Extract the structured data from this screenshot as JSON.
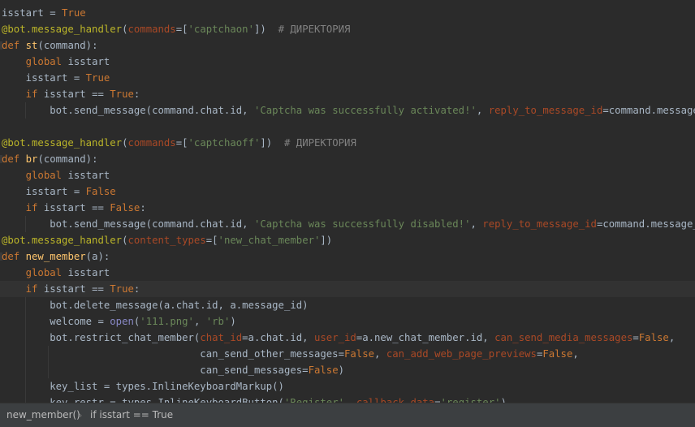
{
  "editor": {
    "lines": [
      "isstart = True",
      "@bot.message_handler(commands=['captchaon'])  # ДИРЕКТОРИЯ",
      "def st(command):",
      "    global isstart",
      "    isstart = True",
      "    if isstart == True:",
      "        bot.send_message(command.chat.id, 'Captcha was successfully activated!', reply_to_message_id=command.message_id)",
      "",
      "@bot.message_handler(commands=['captchaoff'])  # ДИРЕКТОРИЯ",
      "def br(command):",
      "    global isstart",
      "    isstart = False",
      "    if isstart == False:",
      "        bot.send_message(command.chat.id, 'Captcha was successfully disabled!', reply_to_message_id=command.message_id)",
      "@bot.message_handler(content_types=['new_chat_member'])",
      "def new_member(a):",
      "    global isstart",
      "    if isstart == True:",
      "        bot.delete_message(a.chat.id, a.message_id)",
      "        welcome = open('111.png', 'rb')",
      "        bot.restrict_chat_member(chat_id=a.chat.id, user_id=a.new_chat_member.id, can_send_media_messages=False,",
      "                                 can_send_other_messages=False, can_add_web_page_previews=False,",
      "                                 can_send_messages=False)",
      "        key_list = types.InlineKeyboardMarkup()",
      "        key_restr = types.InlineKeyboardButton('Register', callback_data='register')"
    ]
  },
  "breadcrumb": {
    "items": [
      "new_member()",
      "if isstart == True"
    ],
    "separator_icon": "chevron-right-icon"
  },
  "colors": {
    "background": "#2b2b2b",
    "keyword": "#cc7832",
    "decorator": "#bbb529",
    "string": "#6a8759",
    "param": "#aa4926",
    "comment": "#808080",
    "function": "#ffc66d",
    "text": "#a9b7c6"
  }
}
